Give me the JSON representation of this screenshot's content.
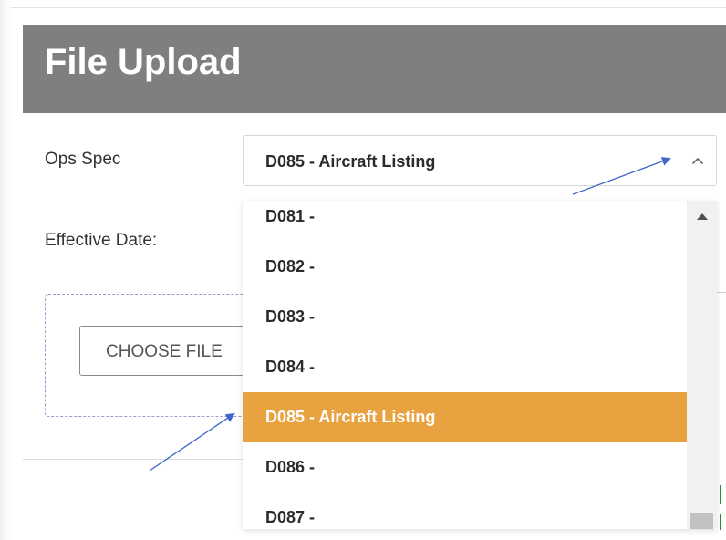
{
  "header": {
    "title": "File Upload"
  },
  "form": {
    "ops_spec_label": "Ops Spec",
    "effective_date_label": "Effective Date:",
    "ops_spec_selected": "D085 - Aircraft Listing",
    "choose_file_label": "CHOOSE FILE"
  },
  "dropdown": {
    "options": [
      "D081 -",
      "D082 -",
      "D083 -",
      "D084 -",
      "D085 - Aircraft Listing",
      "D086 -",
      "D087 -"
    ],
    "selected_index": 4
  },
  "colors": {
    "header_bg": "#7f7f7e",
    "selected_option_bg": "#e8a23f",
    "annotation_arrow": "#3f67c8"
  },
  "icons": {
    "select_toggle": "chevron-up-icon",
    "scroll_up": "scroll-up-arrow-icon"
  }
}
